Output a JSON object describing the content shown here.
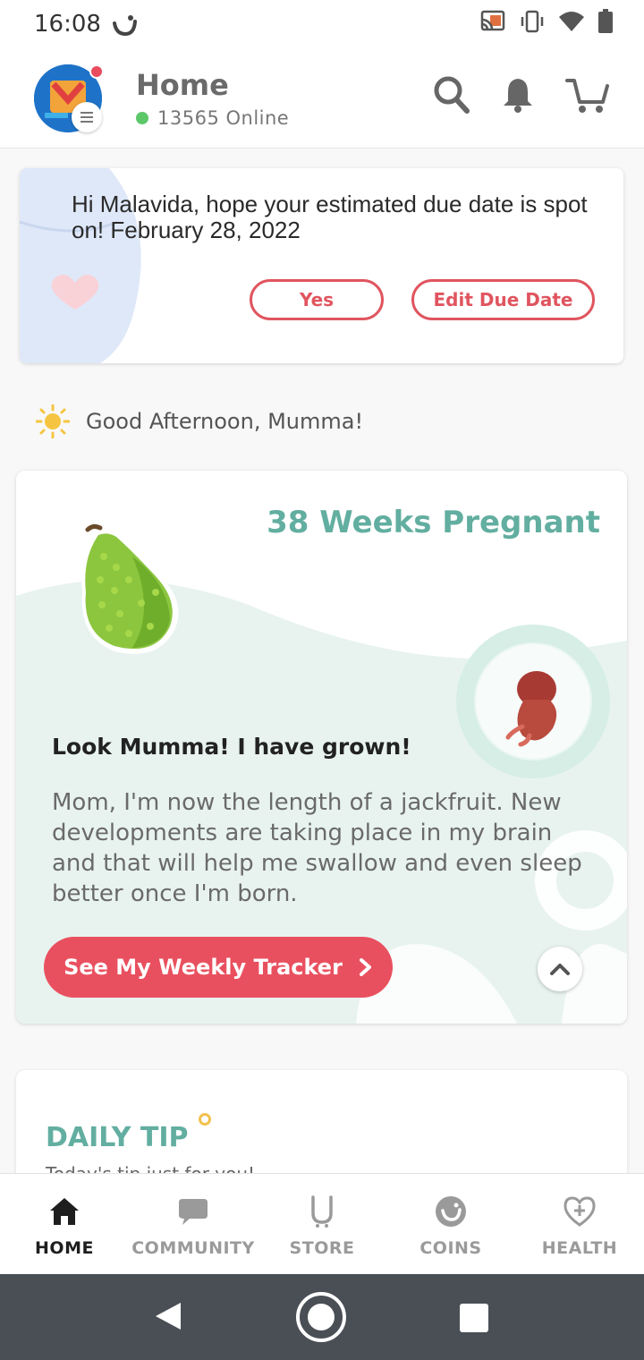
{
  "status_bar": {
    "time": "16:08"
  },
  "header": {
    "title": "Home",
    "online_count": "13565 Online"
  },
  "due_card": {
    "message": "Hi Malavida, hope your estimated due date is spot on! February 28, 2022",
    "yes_label": "Yes",
    "edit_label": "Edit Due Date"
  },
  "greeting": {
    "text": "Good Afternoon, Mumma!"
  },
  "growth_card": {
    "weeks_title": "38 Weeks Pregnant",
    "heading": "Look Mumma! I have grown!",
    "description": "Mom, I'm now the length of a jackfruit. New developments are taking place in my brain and that will help me swallow and even sleep better once I'm born.",
    "tracker_label": "See My Weekly Tracker"
  },
  "daily_tip": {
    "title": "DAILY TIP",
    "subtitle": "Today's tip just for you!"
  },
  "bottom_nav": {
    "items": [
      {
        "label": "HOME",
        "icon": "home-icon",
        "active": true
      },
      {
        "label": "COMMUNITY",
        "icon": "chat-icon",
        "active": false
      },
      {
        "label": "STORE",
        "icon": "store-icon",
        "active": false
      },
      {
        "label": "COINS",
        "icon": "coins-icon",
        "active": false
      },
      {
        "label": "HEALTH",
        "icon": "heart-plus-icon",
        "active": false
      }
    ]
  },
  "colors": {
    "accent_red": "#e9505f",
    "teal": "#62aea0",
    "online_green": "#5cc86a"
  }
}
